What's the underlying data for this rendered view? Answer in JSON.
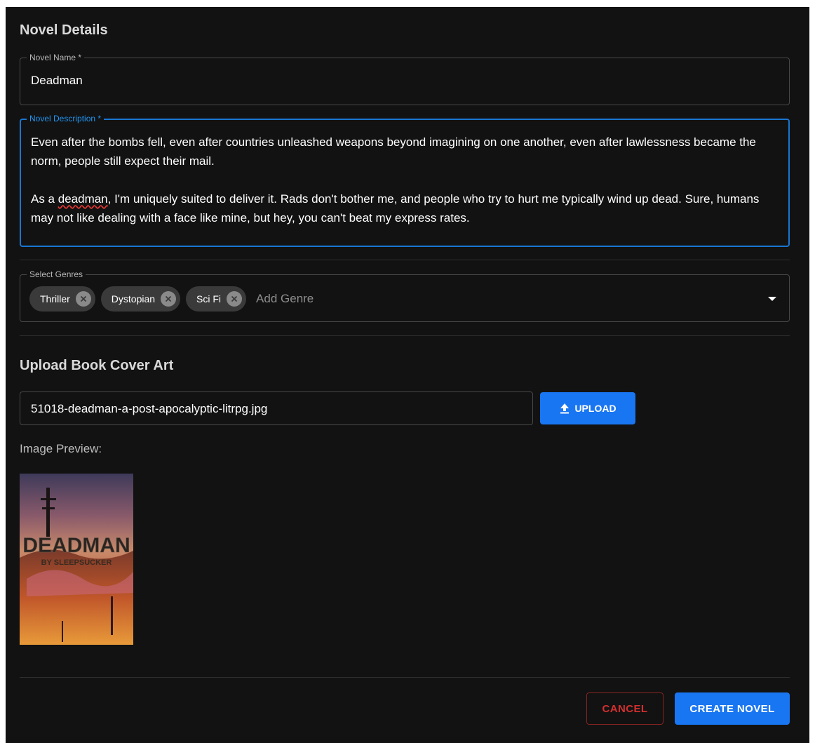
{
  "details": {
    "title": "Novel Details"
  },
  "name_field": {
    "label": "Novel Name *",
    "value": "Deadman"
  },
  "description_field": {
    "label": "Novel Description *",
    "line1": "Even after the bombs fell, even after countries unleashed weapons beyond imagining on one another, even after lawlessness became the norm, people still expect their mail.",
    "line2_before": "As a ",
    "line2_misspelled": "deadman",
    "line2_after": ", I'm uniquely suited to deliver it. Rads don't bother me, and people who try to hurt me typically wind up dead. Sure, humans may not like dealing with a face like mine, but hey, you can't beat my express rates."
  },
  "genres": {
    "label": "Select Genres",
    "chips": [
      "Thriller",
      "Dystopian",
      "Sci Fi"
    ],
    "placeholder": "Add Genre"
  },
  "upload": {
    "title": "Upload Book Cover Art",
    "file_name": "51018-deadman-a-post-apocalyptic-litrpg.jpg",
    "button_label": "UPLOAD",
    "preview_label": "Image Preview:",
    "cover_title": "DEADMAN",
    "cover_author": "BY SLEEPSUCKER"
  },
  "actions": {
    "cancel_label": "CANCEL",
    "create_label": "CREATE NOVEL"
  },
  "colors": {
    "background": "#121212",
    "primary": "#1976f2",
    "danger": "#d32f2f"
  }
}
